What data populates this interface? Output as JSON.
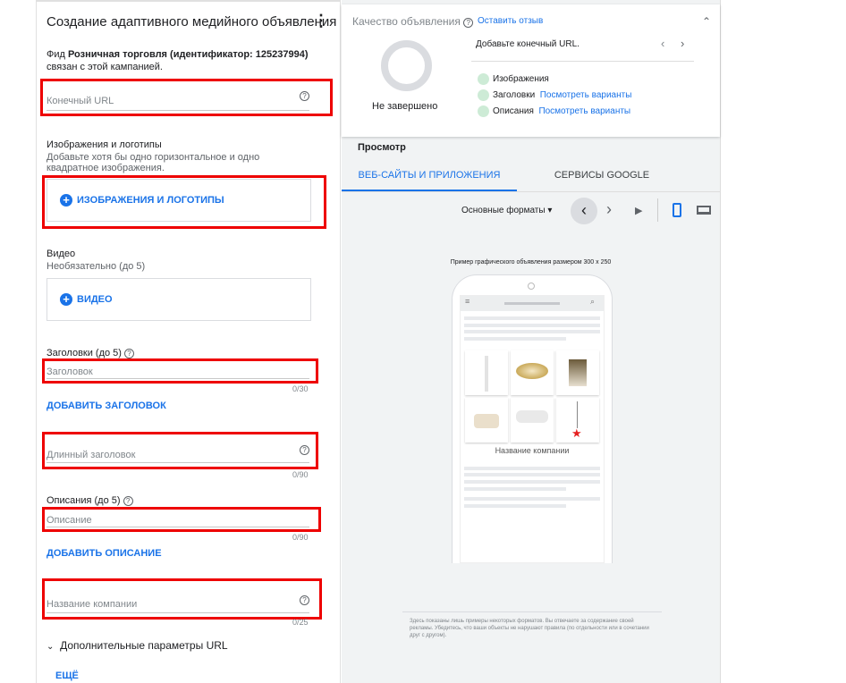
{
  "form": {
    "title": "Создание адаптивного медийного объявления",
    "feed_prefix": "Фид ",
    "feed_name": "Розничная торговля (идентификатор: 125237994)",
    "feed_suffix": " связан с этой кампанией.",
    "final_url_placeholder": "Конечный URL",
    "images_label": "Изображения и логотипы",
    "images_hint": "Добавьте хотя бы одно горизонтальное и одно квадратное изображения.",
    "images_button": "ИЗОБРАЖЕНИЯ И ЛОГОТИПЫ",
    "video_label": "Видео",
    "video_hint": "Необязательно (до 5)",
    "video_button": "ВИДЕО",
    "headlines_label": "Заголовки (до 5)",
    "headline_placeholder": "Заголовок",
    "headline_count": "0/30",
    "add_headline": "ДОБАВИТЬ ЗАГОЛОВОК",
    "long_headline_placeholder": "Длинный заголовок",
    "long_headline_count": "0/90",
    "descriptions_label": "Описания (до 5)",
    "description_placeholder": "Описание",
    "description_count": "0/90",
    "add_description": "ДОБАВИТЬ ОПИСАНИЕ",
    "business_placeholder": "Название компании",
    "business_count": "0/25",
    "url_options": "Дополнительные параметры URL",
    "more": "ЕЩЁ"
  },
  "quality": {
    "title": "Качество объявления",
    "feedback": "Оставить отзыв",
    "status": "Не завершено",
    "tip": "Добавьте конечный URL.",
    "items": [
      {
        "label": "Изображения",
        "link": ""
      },
      {
        "label": "Заголовки",
        "link": "Посмотреть варианты"
      },
      {
        "label": "Описания",
        "link": "Посмотреть варианты"
      }
    ]
  },
  "preview": {
    "title": "Просмотр",
    "tabs": [
      "ВЕБ-САЙТЫ И ПРИЛОЖЕНИЯ",
      "СЕРВИСЫ GOOGLE"
    ],
    "format": "Основные форматы",
    "caption": "Пример графического объявления размером 300 x 250",
    "business_name": "Название компании",
    "disclaimer": "Здесь показаны лишь примеры некоторых форматов. Вы отвечаете за содержание своей рекламы. Убедитесь, что ваши объекты не нарушают правила (по отдельности или в сочетании друг с другом)."
  },
  "colors": {
    "accent": "#1a73e8",
    "highlight": "#ee0000"
  }
}
